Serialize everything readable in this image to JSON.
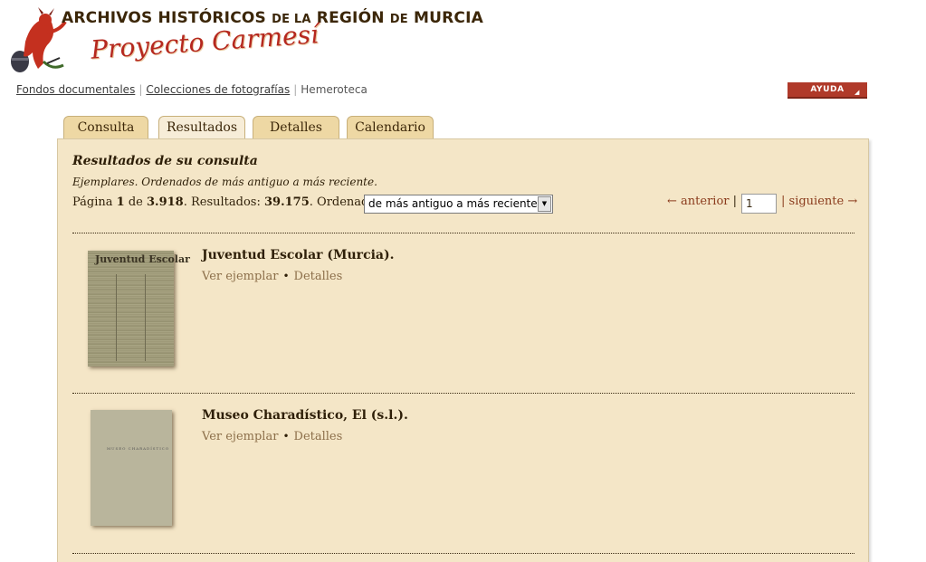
{
  "header": {
    "title_part1": "ARCHIVOS HISTÓRICOS",
    "title_de1": "DE LA",
    "title_region": "REGIÓN",
    "title_de2": "DE",
    "title_murcia": "MURCIA",
    "subtitle": "Proyecto Carmesí"
  },
  "breadcrumb": {
    "items": [
      "Fondos documentales",
      "Colecciones de fotografías"
    ],
    "current": "Hemeroteca"
  },
  "help_button": {
    "label": "AYUDA"
  },
  "tabs": [
    {
      "label": "Consulta"
    },
    {
      "label": "Resultados"
    },
    {
      "label": "Detalles"
    },
    {
      "label": "Calendario"
    }
  ],
  "results": {
    "heading": "Resultados de su consulta",
    "description": "Ejemplares. Ordenados de más antiguo a más reciente.",
    "page_label": "Página",
    "page_current": "1",
    "page_of": "de",
    "page_total": "3.918",
    "results_label": ". Resultados:",
    "results_count": "39.175",
    "ordered_label": ". Ordenados",
    "order_selected": "de más antiguo a más reciente",
    "prev_label": "← anterior",
    "page_input_value": "1",
    "next_label": "siguiente →",
    "separator": "|"
  },
  "items": [
    {
      "title": "Juventud Escolar (Murcia).",
      "thumb_text": "Juventud Escolar",
      "link_view": "Ver ejemplar",
      "link_details": "Detalles"
    },
    {
      "title": "Museo Charadístico, El (s.l.).",
      "thumb_text": "MUSEO CHARADÍSTICO",
      "link_view": "Ver ejemplar",
      "link_details": "Detalles"
    }
  ],
  "colors": {
    "panel_bg": "#f4e6c7",
    "tab_bg": "#eed8a4",
    "help_bg": "#b03a2a",
    "link": "#8c6f4a",
    "logo_red": "#b5281f"
  },
  "icons": [
    "devil-logo-icon",
    "select-arrow-icon",
    "help-triangle-icon"
  ]
}
